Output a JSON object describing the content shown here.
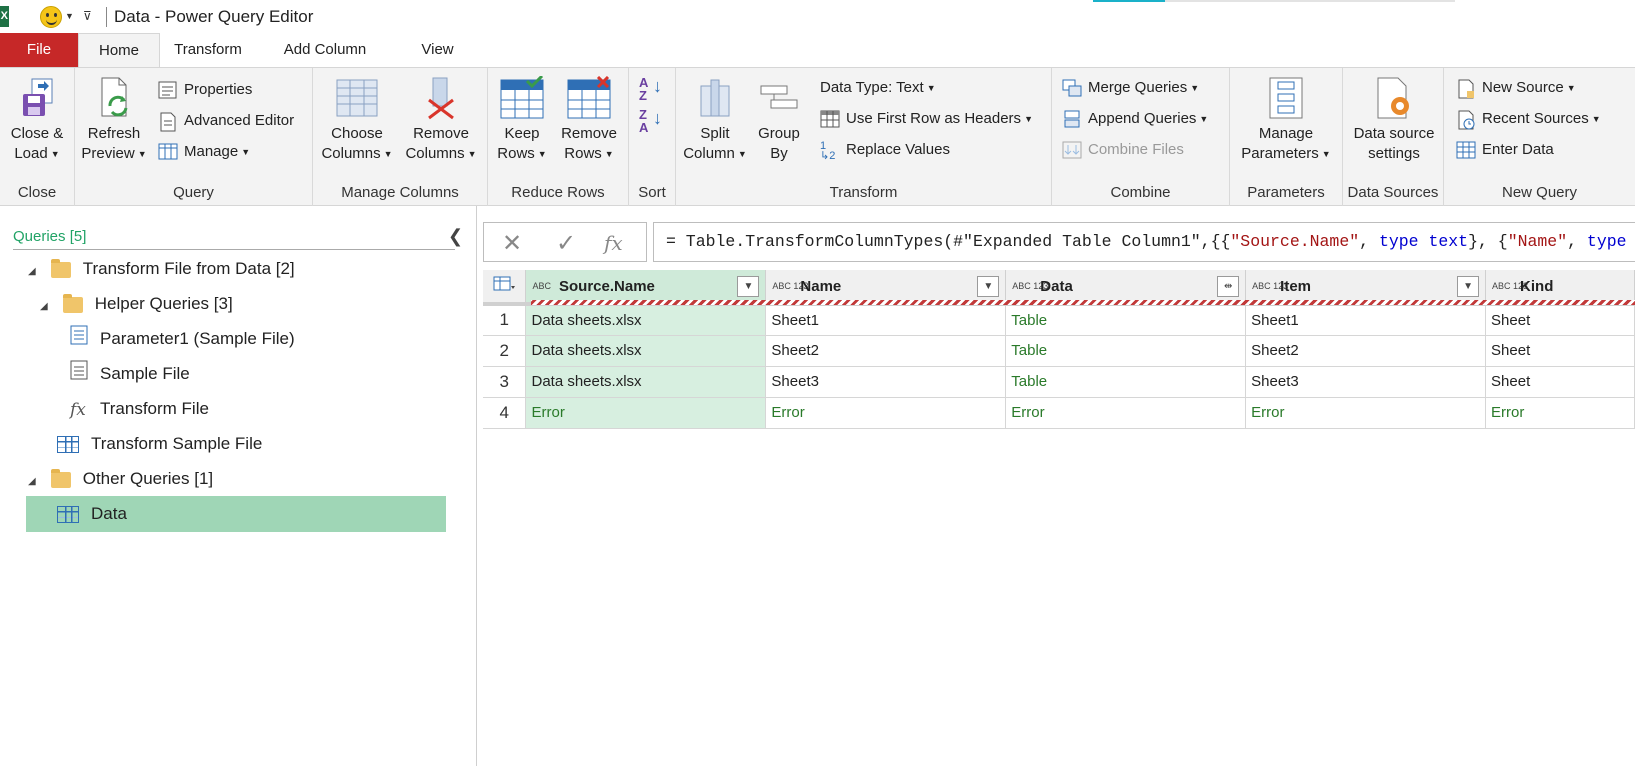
{
  "titlebar": {
    "app_icon": "X",
    "title": "Data - Power Query Editor"
  },
  "tabs": [
    "File",
    "Home",
    "Transform",
    "Add Column",
    "View"
  ],
  "ribbon": {
    "close": {
      "label": "Close",
      "close_load": "Close &",
      "close_load2": "Load"
    },
    "query": {
      "label": "Query",
      "refresh": "Refresh",
      "preview": "Preview",
      "properties": "Properties",
      "advanced_editor": "Advanced Editor",
      "manage": "Manage"
    },
    "manage_columns": {
      "label": "Manage Columns",
      "choose1": "Choose",
      "choose2": "Columns",
      "remove1": "Remove",
      "remove2": "Columns"
    },
    "reduce_rows": {
      "label": "Reduce Rows",
      "keep1": "Keep",
      "keep2": "Rows",
      "remove1": "Remove",
      "remove2": "Rows"
    },
    "sort": {
      "label": "Sort"
    },
    "transform": {
      "label": "Transform",
      "split1": "Split",
      "split2": "Column",
      "group1": "Group",
      "group2": "By",
      "data_type": "Data Type: Text",
      "first_row": "Use First Row as Headers",
      "replace": "Replace Values"
    },
    "combine": {
      "label": "Combine",
      "merge": "Merge Queries",
      "append": "Append Queries",
      "combine_files": "Combine Files"
    },
    "parameters": {
      "label": "Parameters",
      "manage1": "Manage",
      "manage2": "Parameters"
    },
    "data_sources": {
      "label": "Data Sources",
      "ds1": "Data source",
      "ds2": "settings"
    },
    "new_query": {
      "label": "New Query",
      "new_source": "New Source",
      "recent_sources": "Recent Sources",
      "enter_data": "Enter Data"
    }
  },
  "queries": {
    "header": "Queries [5]",
    "items": [
      {
        "label": "Transform File from Data [2]"
      },
      {
        "label": "Helper Queries [3]"
      },
      {
        "label": "Parameter1 (Sample File)"
      },
      {
        "label": "Sample File"
      },
      {
        "label": "Transform File"
      },
      {
        "label": "Transform Sample File"
      },
      {
        "label": "Other Queries [1]"
      },
      {
        "label": "Data"
      }
    ]
  },
  "formula": {
    "prefix": "= Table.TransformColumnTypes(#\"Expanded Table Column1\",{{",
    "s1": "\"Source.Name\"",
    "c1": ", ",
    "k1": "type text",
    "c2": "}, {",
    "s2": "\"Name\"",
    "c3": ", ",
    "k2": "type"
  },
  "grid": {
    "columns": [
      {
        "name": "Source.Name",
        "type": "ABC"
      },
      {
        "name": "Name",
        "type": "ABC 123"
      },
      {
        "name": "Data",
        "type": "ABC 123"
      },
      {
        "name": "Item",
        "type": "ABC 123"
      },
      {
        "name": "Kind",
        "type": "ABC 123"
      }
    ],
    "rows": [
      {
        "n": "1",
        "cells": [
          "Data sheets.xlsx",
          "Sheet1",
          "Table",
          "Sheet1",
          "Sheet"
        ]
      },
      {
        "n": "2",
        "cells": [
          "Data sheets.xlsx",
          "Sheet2",
          "Table",
          "Sheet2",
          "Sheet"
        ]
      },
      {
        "n": "3",
        "cells": [
          "Data sheets.xlsx",
          "Sheet3",
          "Table",
          "Sheet3",
          "Sheet"
        ]
      },
      {
        "n": "4",
        "cells": [
          "Error",
          "Error",
          "Error",
          "Error",
          "Error"
        ]
      }
    ]
  },
  "colors": {
    "file_tab": "#c62828",
    "selected_query": "#9fd6b6",
    "accent_green": "#21a366"
  }
}
